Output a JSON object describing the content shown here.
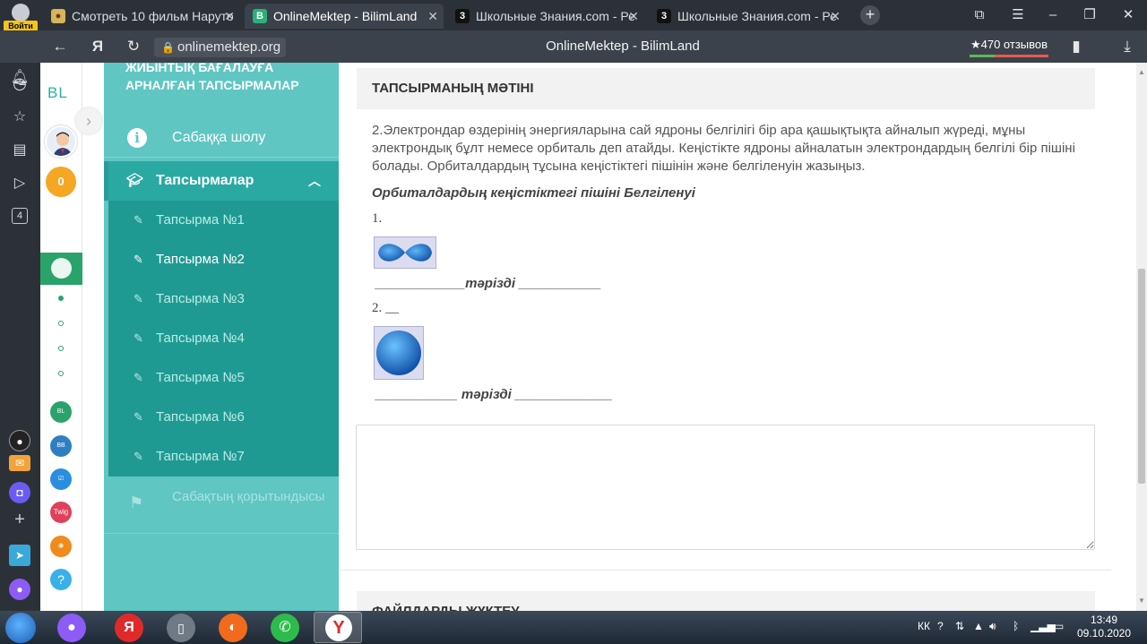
{
  "browser": {
    "tabs": [
      {
        "label": "Смотреть 10 фильм Наруто",
        "active": false
      },
      {
        "label": "OnlineMektep - BilimLand",
        "active": true
      },
      {
        "label": "Школьные Знания.com - Ре",
        "active": false
      },
      {
        "label": "Школьные Знания.com - Ре",
        "active": false
      }
    ],
    "profile_label": "Войти",
    "url": "onlinemektep.org",
    "title": "OnlineMektep - BilimLand",
    "reviews": "★470 отзывов",
    "rail_badge": "4"
  },
  "site": {
    "logo": "BL",
    "score": "0"
  },
  "menu": {
    "heading": "ЖИЫНТЫҚ БАҒАЛАУҒА АРНАЛҒАН ТАПСЫРМАЛАР",
    "overview": "Сабаққа шолу",
    "tasks": "Тапсырмалар",
    "task_items": [
      "Тапсырма №1",
      "Тапсырма №2",
      "Тапсырма №3",
      "Тапсырма №4",
      "Тапсырма №5",
      "Тапсырма №6",
      "Тапсырма №7"
    ],
    "active_index": 1,
    "summary": "Сабақтың қорытындысы"
  },
  "main": {
    "section_title": "ТАПСЫРМАНЫҢ МӘТІНІ",
    "question": "2.Электрондар өздерінің энергияларына сай ядроны белгілігі бір ара қашықтықта айналып жүреді, мұны электрондық бұлт немесе орбиталь деп атайды. Кеңістікте ядроны айналатын электрондардың белгілі бір пішіні болады. Орбиталдардың тұсына кеңістіктегі пішінін және белгіленуін жазыңыз.",
    "subtitle": "Орбиталдардың кеңістіктегі пішіні Белгіленуі",
    "item1_num": "1.",
    "item1_blank": "____________тәрізді ___________",
    "item2_num": "2. __",
    "item2_blank": "___________ тәрізді _____________",
    "upload_title": "ФАЙЛДАРДЫ ЖҮКТЕУ"
  },
  "taskbar": {
    "lang": "КК",
    "time": "13:49",
    "date": "09.10.2020"
  },
  "colors": {
    "menu_bg": "#5fc6c2",
    "menu_active": "#2aa9a3",
    "submenu_bg": "#1f9a92"
  }
}
